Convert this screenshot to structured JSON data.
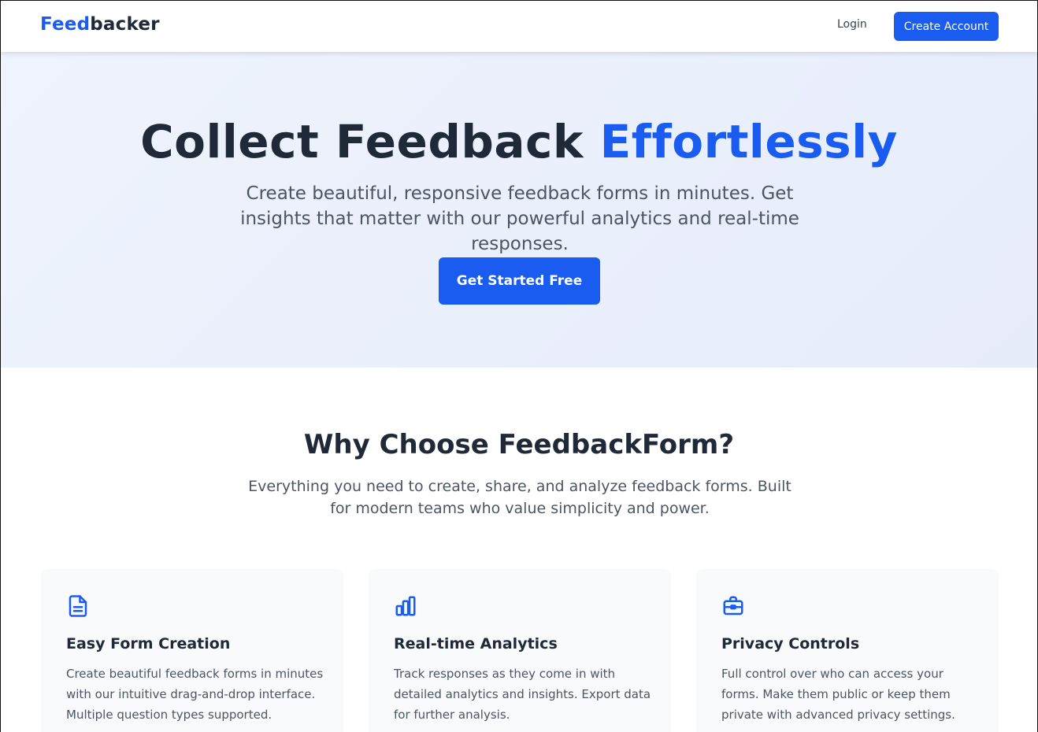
{
  "nav": {
    "logo_part1": "Feed",
    "logo_part2": "backer",
    "login_label": "Login",
    "create_account_label": "Create Account"
  },
  "hero": {
    "title_main": "Collect Feedback ",
    "title_highlight": "Effortlessly",
    "subtitle": "Create beautiful, responsive feedback forms in minutes. Get insights that matter with our powerful analytics and real-time responses.",
    "cta_label": "Get Started Free"
  },
  "features": {
    "title": "Why Choose FeedbackForm?",
    "subtitle": "Everything you need to create, share, and analyze feedback forms. Built for modern teams who value simplicity and power.",
    "cards": [
      {
        "icon": "document-icon",
        "title": "Easy Form Creation",
        "description": "Create beautiful feedback forms in minutes with our intuitive drag-and-drop interface. Multiple question types supported."
      },
      {
        "icon": "bar-chart-icon",
        "title": "Real-time Analytics",
        "description": "Track responses as they come in with detailed analytics and insights. Export data for further analysis."
      },
      {
        "icon": "briefcase-icon",
        "title": "Privacy Controls",
        "description": "Full control over who can access your forms. Make them public or keep them private with advanced privacy settings."
      }
    ]
  },
  "colors": {
    "accent": "#1a5cf0",
    "text_dark": "#1f2937",
    "text_muted": "#4b5563",
    "hero_bg": "#eef3fd",
    "card_bg": "#f8fafc"
  }
}
